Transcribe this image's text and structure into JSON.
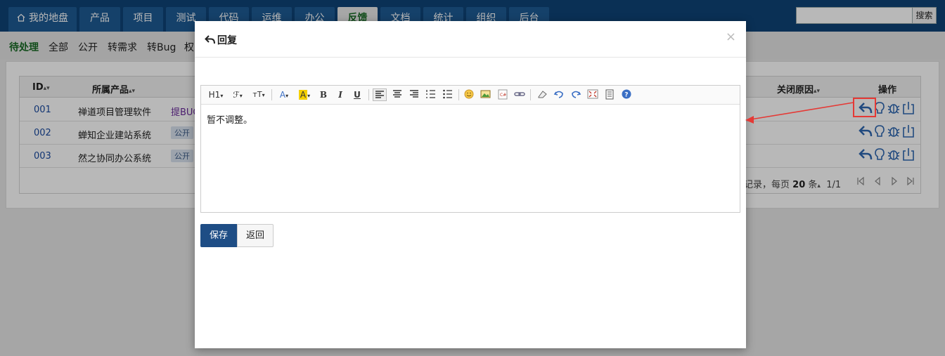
{
  "nav": {
    "tabs": [
      "我的地盘",
      "产品",
      "项目",
      "测试",
      "代码",
      "运维",
      "办公",
      "反馈",
      "文档",
      "统计",
      "组织",
      "后台"
    ],
    "active_index": 7,
    "search_placeholder": "",
    "search_label": "搜索"
  },
  "subnav": {
    "items": [
      "待处理",
      "全部",
      "公开",
      "转需求",
      "转Bug",
      "权"
    ],
    "active_index": 0
  },
  "table": {
    "headers": {
      "id": "ID",
      "product": "所属产品",
      "close_reason": "关闭原因",
      "actions": "操作"
    },
    "rows": [
      {
        "id": "001",
        "product": "禅道项目管理软件",
        "extra": "提BUG",
        "tag": ""
      },
      {
        "id": "002",
        "product": "蝉知企业建站系统",
        "extra": "",
        "tag": "公开"
      },
      {
        "id": "003",
        "product": "然之协同办公系统",
        "extra": "",
        "tag": "公开"
      }
    ],
    "pager": {
      "text": "记录，每页",
      "per_page": "20",
      "unit": "条",
      "pages": "1/1"
    }
  },
  "modal": {
    "title": "回复",
    "close": "×",
    "toolbar": {
      "heading": "H1",
      "font": "ℱ",
      "size": "тT"
    },
    "content": "暂不调整。",
    "save_label": "保存",
    "back_label": "返回"
  },
  "colors": {
    "nav_bg": "#0e4377",
    "primary": "#1e4d85",
    "active_green": "#1a6b26",
    "highlight_red": "#e53935"
  }
}
